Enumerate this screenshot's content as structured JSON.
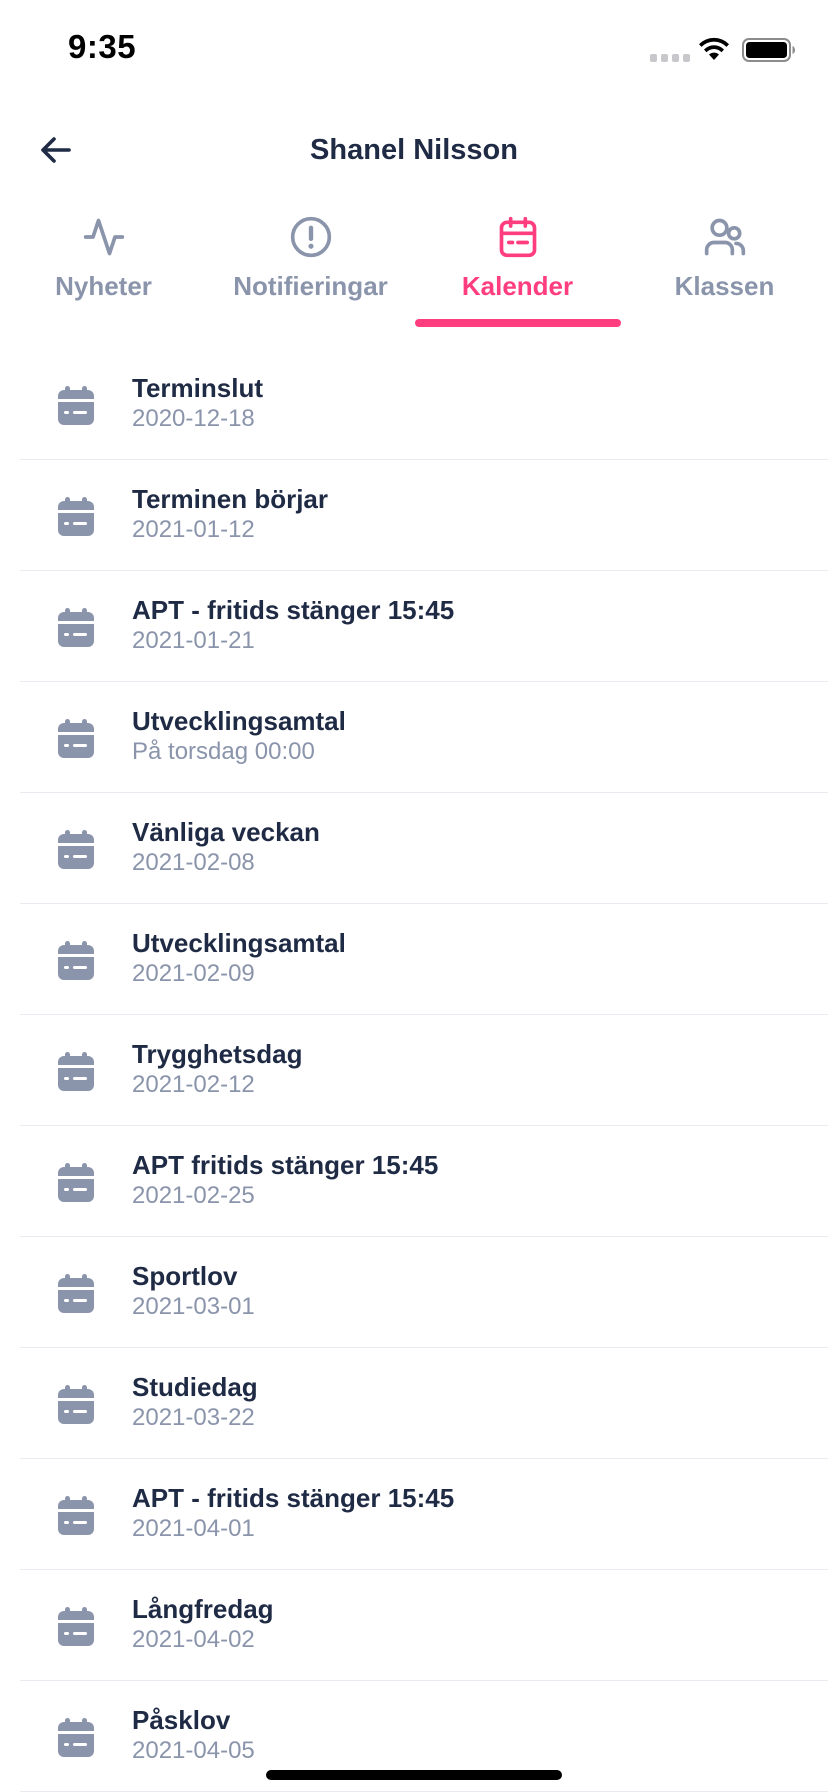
{
  "status_bar": {
    "time": "9:35",
    "icons": [
      "signal-icon",
      "wifi-icon",
      "battery-icon"
    ]
  },
  "header": {
    "title": "Shanel Nilsson",
    "back_icon": "arrow-left-icon"
  },
  "tabs": [
    {
      "label": "Nyheter",
      "icon": "activity-icon",
      "active": false
    },
    {
      "label": "Notifieringar",
      "icon": "alert-circle-icon",
      "active": false
    },
    {
      "label": "Kalender",
      "icon": "calendar-icon",
      "active": true
    },
    {
      "label": "Klassen",
      "icon": "users-icon",
      "active": false
    }
  ],
  "events": [
    {
      "title": "Terminslut",
      "date": "2020-12-18"
    },
    {
      "title": "Terminen börjar",
      "date": "2021-01-12"
    },
    {
      "title": "APT - fritids stänger 15:45",
      "date": "2021-01-21"
    },
    {
      "title": "Utvecklingsamtal",
      "date": "På torsdag 00:00"
    },
    {
      "title": "Vänliga veckan",
      "date": "2021-02-08"
    },
    {
      "title": "Utvecklingsamtal",
      "date": "2021-02-09"
    },
    {
      "title": "Trygghetsdag",
      "date": "2021-02-12"
    },
    {
      "title": "APT fritids stänger 15:45",
      "date": "2021-02-25"
    },
    {
      "title": "Sportlov",
      "date": "2021-03-01"
    },
    {
      "title": "Studiedag",
      "date": "2021-03-22"
    },
    {
      "title": "APT - fritids stänger 15:45",
      "date": "2021-04-01"
    },
    {
      "title": "Långfredag",
      "date": "2021-04-02"
    },
    {
      "title": "Påsklov",
      "date": "2021-04-05"
    }
  ],
  "colors": {
    "accent": "#ff3d7f",
    "text_primary": "#1f2a44",
    "text_secondary": "#8a94ab",
    "icon_gray": "#8a94ab",
    "divider": "#e8ebf0"
  }
}
